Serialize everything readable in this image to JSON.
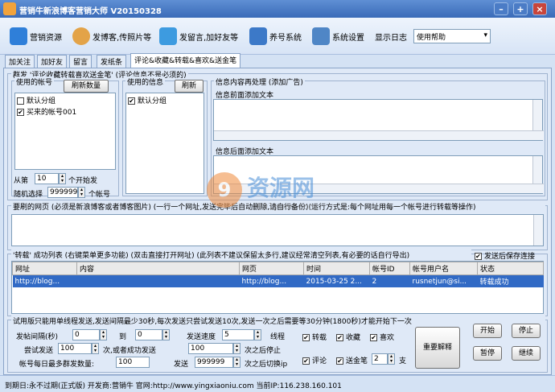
{
  "window": {
    "title": "营销牛新浪博客营销大师 V20150328"
  },
  "toolbar": {
    "buttons": [
      {
        "label": "营销资源",
        "icon": "dropbox-icon"
      },
      {
        "label": "发博客,传照片等",
        "icon": "user-icon"
      },
      {
        "label": "发留言,加好友等",
        "icon": "mail-icon"
      },
      {
        "label": "养号系统",
        "icon": "windows-icon"
      },
      {
        "label": "系统设置",
        "icon": "wrench-icon"
      }
    ],
    "show_log": "显示日志",
    "help_select": "使用帮助"
  },
  "tabs": [
    "加关注",
    "加好友",
    "留言",
    "发纸条",
    "评论&收藏&转载&喜欢&送金笔"
  ],
  "group": {
    "title": "群发 '评论收藏转载喜欢送金笔' (评论信息不是必须的)",
    "accounts_label": "使用的帐号",
    "refresh_count": "刷新数量",
    "accounts": [
      {
        "label": "默认分组",
        "checked": false
      },
      {
        "label": "买来的帐号001",
        "checked": true
      }
    ],
    "info_label": "使用的信息",
    "refresh": "刷新",
    "info_items": [
      {
        "label": "默认分组",
        "checked": true
      }
    ],
    "from_label": "从第",
    "from_value": "10",
    "from_suffix": "个开始发",
    "random_label": "随机选择",
    "random_value": "999999",
    "random_suffix": "个帐号",
    "reprocess_title": "信息内容再处理 (添加广告)",
    "prefix_title": "信息前面添加文本",
    "suffix_title": "信息后面添加文本"
  },
  "target": {
    "title": "要刷的网页 (必须是新浪博客或者博客图片) (一行一个网址,发送完毕后自动删除,请自行备份)(运行方式是:每个网址用每一个帐号进行转载等操作)"
  },
  "result": {
    "title": "'转载' 成功列表 (右键菜单更多功能) (双击直接打开网址) (此列表不建议保留太多行,建议经常清空列表,有必要的话自行导出)",
    "save_after": "发送后保存连接",
    "columns": [
      "网址",
      "内容",
      "网页",
      "时间",
      "帐号ID",
      "帐号用户名",
      "状态"
    ],
    "rows": [
      [
        "http://blog...",
        "",
        "http://blog...",
        "2015-03-25 2...",
        "2",
        "rusnetjun@si...",
        "转载成功"
      ]
    ]
  },
  "settings": {
    "title": "试用版只能用单线程发送,发送间隔最少30秒,每次发送只尝试发送10次,发送一次之后需要等30分钟(1800秒)才能开始下一次",
    "interval_label": "发帖间隔(秒)",
    "interval_from": "0",
    "to_label": "到",
    "interval_to": "0",
    "speed_label": "发送速度",
    "speed_value": "5",
    "speed_unit": "线程",
    "try_label": "尝试发送",
    "try_value": "100",
    "try_mid": "次,或者成功发送",
    "success_value": "100",
    "stop_label": "次之后停止",
    "max_label": "帐号每日最多群发数量:",
    "max_value": "100",
    "send_label": "发送",
    "send_value": "999999",
    "switch_label": "次之后切换ip",
    "opt_repost": "转载",
    "opt_fav": "收藏",
    "opt_like": "喜欢",
    "opt_comment": "评论",
    "opt_pen": "送金笔",
    "pen_value": "2",
    "pen_unit": "支",
    "explain": "重要解释",
    "start": "开始",
    "stop": "停止",
    "pause": "暂停",
    "resume": "继续"
  },
  "watermark": {
    "main": "资源网",
    "sub": "991yuan.com"
  },
  "status": {
    "text": "到期日:永不过期(正式版)  开发商:营销牛  官网:http://www.yingxiaoniu.com  当前IP:116.238.160.101"
  }
}
